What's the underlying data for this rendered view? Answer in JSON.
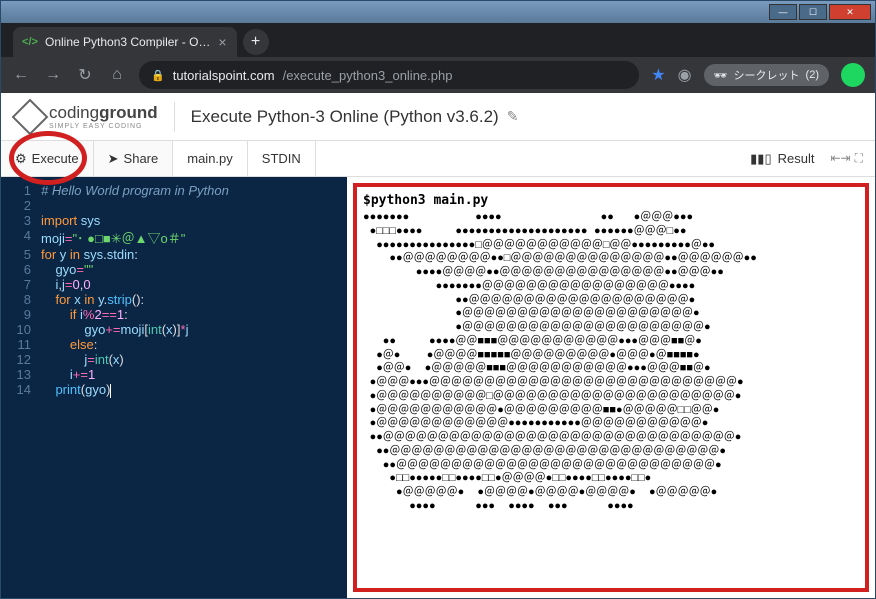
{
  "window": {
    "tab_title": "Online Python3 Compiler - O…"
  },
  "browser": {
    "url_domain": "tutorialspoint.com",
    "url_path": "/execute_python3_online.php",
    "incognito_label": "シークレット",
    "incognito_count": "(2)"
  },
  "logo": {
    "part1": "coding",
    "part2": "ground",
    "tagline": "SIMPLY EASY CODING"
  },
  "page_title": "Execute Python-3 Online (Python v3.6.2)",
  "toolbar": {
    "execute": "Execute",
    "share": "Share",
    "tab_main": "main.py",
    "tab_stdin": "STDIN",
    "result": "Result"
  },
  "code": {
    "lines": [
      {
        "n": 1,
        "html": "<span class='c-comment'># Hello World program in Python</span>"
      },
      {
        "n": 2,
        "html": ""
      },
      {
        "n": 3,
        "html": "<span class='c-kw'>import</span> <span class='c-var'>sys</span>"
      },
      {
        "n": 4,
        "html": "<span class='c-var'>moji</span><span class='c-op'>=</span><span class='c-str'>\"･ ●□■✳＠▲▽o＃\"</span>"
      },
      {
        "n": 5,
        "html": "<span class='c-kw'>for</span> <span class='c-var'>y</span> <span class='c-kw'>in</span> <span class='c-var'>sys</span>.<span class='c-var'>stdin</span>:"
      },
      {
        "n": 6,
        "html": "    <span class='c-var'>gyo</span><span class='c-op'>=</span><span class='c-str'>\"\"</span>"
      },
      {
        "n": 7,
        "html": "    <span class='c-var'>i</span>,<span class='c-var'>j</span><span class='c-op'>=</span><span class='c-num'>0</span>,<span class='c-num'>0</span>"
      },
      {
        "n": 8,
        "html": "    <span class='c-kw'>for</span> <span class='c-var'>x</span> <span class='c-kw'>in</span> <span class='c-var'>y</span>.<span class='c-fn'>strip</span>():"
      },
      {
        "n": 9,
        "html": "        <span class='c-kw'>if</span> <span class='c-var'>i</span><span class='c-op'>%</span><span class='c-num'>2</span><span class='c-op'>==</span><span class='c-num'>1</span>:"
      },
      {
        "n": 10,
        "html": "            <span class='c-var'>gyo</span><span class='c-op'>+=</span><span class='c-var'>moji</span>[<span class='c-builtin'>int</span>(<span class='c-var'>x</span>)]<span class='c-op'>*</span><span class='c-var'>j</span>"
      },
      {
        "n": 11,
        "html": "        <span class='c-kw'>else</span>:"
      },
      {
        "n": 12,
        "html": "            <span class='c-var'>j</span><span class='c-op'>=</span><span class='c-builtin'>int</span>(<span class='c-var'>x</span>)"
      },
      {
        "n": 13,
        "html": "        <span class='c-var'>i</span><span class='c-op'>+=</span><span class='c-num'>1</span>"
      },
      {
        "n": 14,
        "html": "    <span class='c-fn'>print</span>(<span class='c-var'>gyo</span>)<span class='cursor'></span>"
      }
    ]
  },
  "output": {
    "command": "$python3 main.py",
    "art": "●●●●●●●          ●●●●               ●●   ●＠＠＠●●●\n ●□□□●●●●     ●●●●●●●●●●●●●●●●●●●● ●●●●●●＠＠＠□●●\n  ●●●●●●●●●●●●●●●□＠＠＠＠＠＠＠＠＠＠＠□＠＠●●●●●●●●●＠●●\n    ●●＠＠＠＠＠＠＠＠●●□＠＠＠＠＠＠＠＠＠＠＠＠＠＠●●＠＠＠＠＠＠●●\n        ●●●●＠＠＠＠●●＠＠＠＠＠＠＠＠＠＠＠＠＠＠＠●●＠＠＠●●\n           ●●●●●●●＠＠＠＠＠＠＠＠＠＠＠＠＠＠＠＠＠●●●●\n              ●●＠＠＠＠＠＠＠＠＠＠＠＠＠＠＠＠＠＠＠＠●\n              ●＠＠＠＠＠＠＠＠＠＠＠＠＠＠＠＠＠＠＠＠＠●\n              ●＠＠＠＠＠＠＠＠＠＠＠＠＠＠＠＠＠＠＠＠＠＠●\n   ●●     ●●●●＠＠■■■＠＠＠＠＠＠＠＠＠＠＠●●●＠＠＠■■＠●\n  ●＠●    ●＠＠＠＠■■■■■＠＠＠＠＠＠＠＠＠●＠＠＠●＠■■■■●\n  ●＠＠●  ●＠＠＠＠＠■■■＠＠＠＠＠＠＠＠＠＠＠●●●＠＠＠■■＠●\n ●＠＠＠●●●＠＠＠＠＠＠＠＠＠＠＠＠＠＠＠＠＠＠＠＠＠＠＠＠＠＠＠＠●\n ●＠＠＠＠＠＠＠＠＠＠□＠＠＠＠＠＠＠＠＠＠＠＠＠＠＠＠＠＠＠＠＠＠●\n ●＠＠＠＠＠＠＠＠＠＠＠●＠＠＠＠＠＠＠＠＠■■●＠＠＠＠＠□□＠＠●\n ●＠＠＠＠＠＠＠＠＠＠＠＠●●●●●●●●●●●＠＠＠＠＠＠＠＠＠＠＠●\n ●●＠＠＠＠＠＠＠＠＠＠＠＠＠＠＠＠＠＠＠＠＠＠＠＠＠＠＠＠＠＠＠＠●\n  ●●＠＠＠＠＠＠＠＠＠＠＠＠＠＠＠＠＠＠＠＠＠＠＠＠＠＠＠＠＠＠●\n   ●●＠＠＠＠＠＠＠＠＠＠＠＠＠＠＠＠＠＠＠＠＠＠＠＠＠＠＠＠＠●\n    ●□□●●●●●□□●●●●□□●＠＠＠＠●□□●●●●□□●●●●□□●\n     ●＠＠＠＠＠●  ●＠＠＠＠●＠＠＠＠●＠＠＠＠●  ●＠＠＠＠＠●\n       ●●●●      ●●●  ●●●●  ●●●      ●●●●"
  }
}
